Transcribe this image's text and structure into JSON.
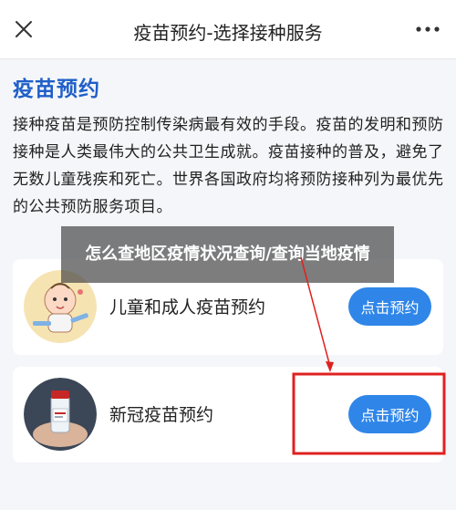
{
  "header": {
    "title": "疫苗预约-选择接种服务",
    "close_icon": "close-icon",
    "more_icon": "more-horizontal-icon"
  },
  "main": {
    "heading": "疫苗预约",
    "intro": "接种疫苗是预防控制传染病最有效的手段。疫苗的发明和预防接种是人类最伟大的公共卫生成就。疫苗接种的普及，避免了无数儿童残疾和死亡。世界各国政府均将预防接种列为最优先的公共预防服务项目。",
    "services": [
      {
        "label": "儿童和成人疫苗预约",
        "button": "点击预约",
        "icon": "baby-vaccine-icon"
      },
      {
        "label": "新冠疫苗预约",
        "button": "点击预约",
        "icon": "vaccine-vial-icon"
      }
    ]
  },
  "overlay": {
    "caption": "怎么查地区疫情状况查询/查询当地疫情"
  },
  "colors": {
    "accent": "#2f86e8",
    "heading": "#1f5fc8",
    "annotation": "#e02020",
    "background": "#f4f6f9"
  }
}
